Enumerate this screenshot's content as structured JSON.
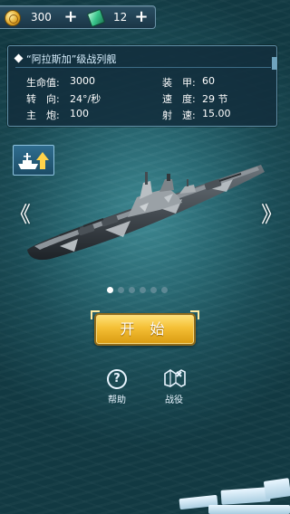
{
  "resources": {
    "coins": "300",
    "gems": "12",
    "plus": "+"
  },
  "ship_info": {
    "title": "“阿拉斯加”级战列舰",
    "stats": {
      "hp_label": "生命值:",
      "hp_value": "3000",
      "armor_label": "装　甲:",
      "armor_value": "60",
      "turn_label": "转　向:",
      "turn_value": "24°/秒",
      "speed_label": "速　度:",
      "speed_value": "29 节",
      "gun_label": "主　炮:",
      "gun_value": "100",
      "rate_label": "射　速:",
      "rate_value": "15.00"
    }
  },
  "carousel": {
    "left": "《",
    "right": "》",
    "page_count": 6,
    "active_page": 1
  },
  "actions": {
    "start": "开 始",
    "help_icon": "?",
    "help": "帮助",
    "campaign": "战役"
  },
  "icons": [
    "coin-icon",
    "gem-icon",
    "upgrade-icon",
    "help-icon",
    "campaign-icon"
  ],
  "colors": {
    "accent_gold": "#f4bf35",
    "panel_border": "#5f8ea6",
    "sea": "#2a6a74"
  }
}
